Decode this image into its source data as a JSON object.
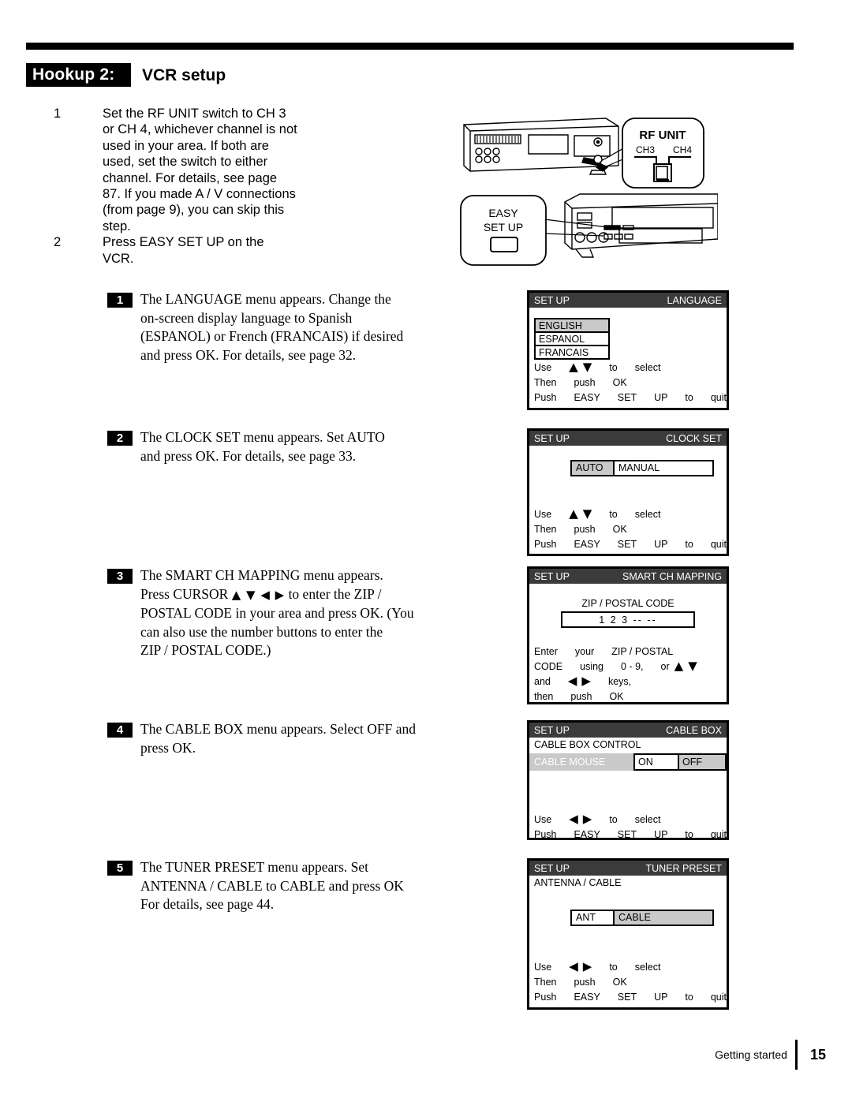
{
  "header": {
    "badge": "Hookup 2:",
    "title": "VCR setup"
  },
  "steps": [
    {
      "num": "1",
      "text": "Set the RF UNIT switch to CH 3\nor CH 4, whichever channel is not\nused in your area.  If both are\nused, set the switch to either\nchannel.  For details, see page\n87.  If you made A / V connections\n(from page 9), you can skip this\nstep."
    },
    {
      "num": "2",
      "text": "Press EASY SET UP on the\nVCR."
    }
  ],
  "substeps": [
    {
      "chip": "1",
      "text_before": "The LANGUAGE menu appears.  Change the\non-screen display language to Spanish\n(ESPANOL) or French (FRANCAIS) if desired\nand press OK.  For details, see page 32.",
      "arrows": "",
      "text_after": ""
    },
    {
      "chip": "2",
      "text_before": "The CLOCK SET menu appears.  Set AUTO\nand press OK.  For details, see page 33.",
      "arrows": "",
      "text_after": ""
    },
    {
      "chip": "3",
      "text_before": "The SMART CH MAPPING menu appears.\nPress CURSOR ",
      "arrows": "▲ ▼ ◀ ▶",
      "text_after": "  to enter the ZIP /\nPOSTAL CODE in your area and press OK. (You\ncan also use the number buttons to enter the\nZIP / POSTAL CODE.)"
    },
    {
      "chip": "4",
      "text_before": "The CABLE BOX menu appears.  Select OFF and\npress OK.",
      "arrows": "",
      "text_after": ""
    },
    {
      "chip": "5",
      "text_before": "The TUNER PRESET menu appears.  Set\nANTENNA / CABLE to CABLE and press OK\nFor details, see page 44.",
      "arrows": "",
      "text_after": ""
    }
  ],
  "illustration": {
    "rf_unit": {
      "title": "RF UNIT",
      "ch3": "CH3",
      "ch4": "CH4"
    },
    "easy_set_up": {
      "line1": "EASY",
      "line2": "SET UP"
    }
  },
  "osd": {
    "common": {
      "set_up": "SET UP",
      "use": "Use",
      "to": "to",
      "select": "select",
      "then": "Then",
      "push": "push",
      "ok": "OK",
      "push2": "Push",
      "easy": "EASY",
      "set": "SET",
      "up": "UP",
      "to2": "to",
      "quit": "quit",
      "arrow_up": "▲",
      "arrow_down": "▼",
      "arrow_left": "◀",
      "arrow_right": "▶"
    },
    "language": {
      "title": "LANGUAGE",
      "options": [
        "ENGLISH",
        "ESPANOL",
        "FRANCAIS"
      ],
      "selected": "ENGLISH"
    },
    "clock_set": {
      "title": "CLOCK SET",
      "option_a": "AUTO",
      "option_b": "MANUAL",
      "selected": "AUTO"
    },
    "smart_ch_mapping": {
      "title": "SMART CH MAPPING",
      "zip_label": "ZIP / POSTAL CODE",
      "zip_value": "1 2 3 -- --",
      "help_l1a": "Enter",
      "help_l1b": "your",
      "help_l1c": "ZIP / POSTAL",
      "help_l2a": "CODE",
      "help_l2b": "using",
      "help_l2c": "0 - 9,",
      "help_l2d": "or",
      "help_l3a": "and",
      "help_l3b": "keys,",
      "help_l4a": "then",
      "help_l4b": "push",
      "help_l4c": "OK"
    },
    "cable_box": {
      "title": "CABLE BOX",
      "control_label": "CABLE BOX CONTROL",
      "row_name": "CABLE MOUSE",
      "on": "ON",
      "off": "OFF",
      "selected": "OFF"
    },
    "tuner_preset": {
      "title": "TUNER PRESET",
      "sub_label": "ANTENNA / CABLE",
      "option_a": "ANT",
      "option_b": "CABLE",
      "selected": "CABLE"
    }
  },
  "footer": {
    "section": "Getting started",
    "page": "15"
  },
  "colors": {
    "osd_title_bg": "#3b3b3b",
    "osd_selected_bg": "#c9c9c9",
    "ink": "#000000"
  }
}
